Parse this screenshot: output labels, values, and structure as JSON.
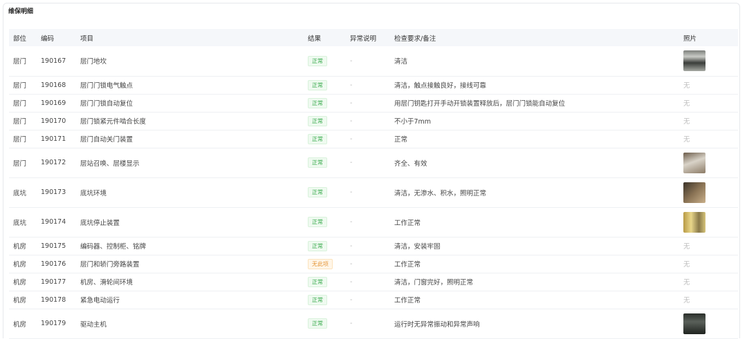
{
  "section": {
    "title": "维保明细"
  },
  "columns": {
    "part": "部位",
    "code": "编码",
    "item": "项目",
    "result": "结果",
    "abnormal": "异常说明",
    "requirement": "检查要求/备注",
    "photo": "照片"
  },
  "status_colors": {
    "normal": "#36a94a",
    "not_applicable": "#e5973a"
  },
  "rows": [
    {
      "part": "层门",
      "code": "190167",
      "item": "层门地坎",
      "result": "正常",
      "abnormal": "-",
      "requirement": "清洁",
      "photo": ""
    },
    {
      "part": "层门",
      "code": "190168",
      "item": "层门门锁电气触点",
      "result": "正常",
      "abnormal": "-",
      "requirement": "清洁，触点接触良好，接线可靠",
      "photo": "无"
    },
    {
      "part": "层门",
      "code": "190169",
      "item": "层门门锁自动复位",
      "result": "正常",
      "abnormal": "-",
      "requirement": "用层门钥匙打开手动开锁装置释放后，层门门锁能自动复位",
      "photo": "无"
    },
    {
      "part": "层门",
      "code": "190170",
      "item": "层门锁紧元件啮合长度",
      "result": "正常",
      "abnormal": "-",
      "requirement": "不小于7mm",
      "photo": "无"
    },
    {
      "part": "层门",
      "code": "190171",
      "item": "层门自动关门装置",
      "result": "正常",
      "abnormal": "-",
      "requirement": "正常",
      "photo": "无"
    },
    {
      "part": "层门",
      "code": "190172",
      "item": "层站召唤、层楼显示",
      "result": "正常",
      "abnormal": "-",
      "requirement": "齐全、有效",
      "photo": ""
    },
    {
      "part": "底坑",
      "code": "190173",
      "item": "底坑环境",
      "result": "正常",
      "abnormal": "-",
      "requirement": "清洁，无渗水、积水，照明正常",
      "photo": ""
    },
    {
      "part": "底坑",
      "code": "190174",
      "item": "底坑停止装置",
      "result": "正常",
      "abnormal": "-",
      "requirement": "工作正常",
      "photo": ""
    },
    {
      "part": "机房",
      "code": "190175",
      "item": "编码器、控制柜、铭牌",
      "result": "正常",
      "abnormal": "-",
      "requirement": "清洁，安装牢固",
      "photo": "无"
    },
    {
      "part": "机房",
      "code": "190176",
      "item": "层门和轿门旁路装置",
      "result": "无此项",
      "abnormal": "-",
      "requirement": "工作正常",
      "photo": "无"
    },
    {
      "part": "机房",
      "code": "190177",
      "item": "机房、滑轮间环境",
      "result": "正常",
      "abnormal": "-",
      "requirement": "清洁，门窗完好，照明正常",
      "photo": "无"
    },
    {
      "part": "机房",
      "code": "190178",
      "item": "紧急电动运行",
      "result": "正常",
      "abnormal": "-",
      "requirement": "工作正常",
      "photo": "无"
    },
    {
      "part": "机房",
      "code": "190179",
      "item": "驱动主机",
      "result": "正常",
      "abnormal": "-",
      "requirement": "运行时无异常振动和异常声响",
      "photo": ""
    }
  ]
}
